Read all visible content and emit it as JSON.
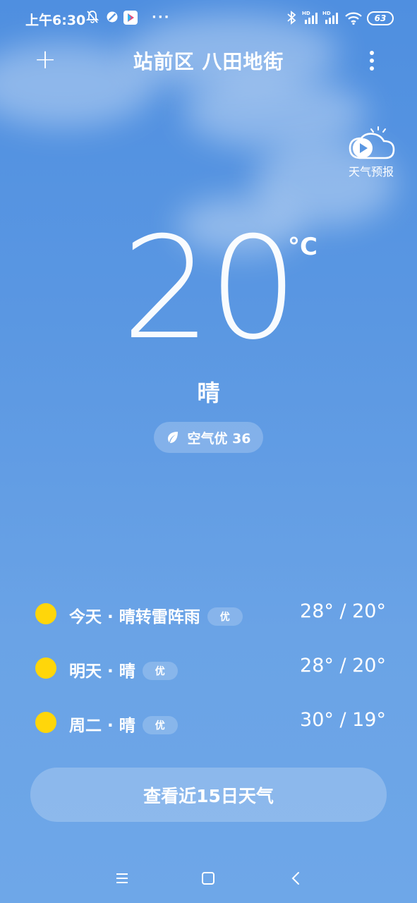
{
  "status_bar": {
    "time": "上午6:30",
    "more": "···",
    "battery": "63",
    "icons": [
      "mute-bell-icon",
      "blocked-icon",
      "play-store-icon",
      "bluetooth-icon",
      "hd-signal-icon",
      "hd-signal-icon",
      "wifi-icon",
      "battery-icon"
    ]
  },
  "header": {
    "add_label": "+",
    "location": "站前区 八田地街",
    "menu_icon": "more-vertical-icon"
  },
  "weather_video": {
    "label": "天气预报",
    "icon": "play-cloud-icon"
  },
  "current": {
    "temperature": "20",
    "unit": "°C",
    "condition": "晴",
    "aqi": "空气优 36",
    "aqi_icon": "leaf-icon"
  },
  "forecast": [
    {
      "day": "今天 · 晴转雷阵雨",
      "aqi": "优",
      "temps": "28° / 20°",
      "icon": "sun-icon"
    },
    {
      "day": "明天 · 晴",
      "aqi": "优",
      "temps": "28° / 20°",
      "icon": "sun-icon"
    },
    {
      "day": "周二 · 晴",
      "aqi": "优",
      "temps": "30° / 19°",
      "icon": "sun-icon"
    }
  ],
  "button_15day": "查看近15日天气",
  "nav": [
    "menu-icon",
    "home-icon",
    "back-icon"
  ],
  "colors": {
    "sky_top": "#4f8fe0",
    "sky_bottom": "#6ea7e8",
    "sun": "#ffd60a"
  }
}
